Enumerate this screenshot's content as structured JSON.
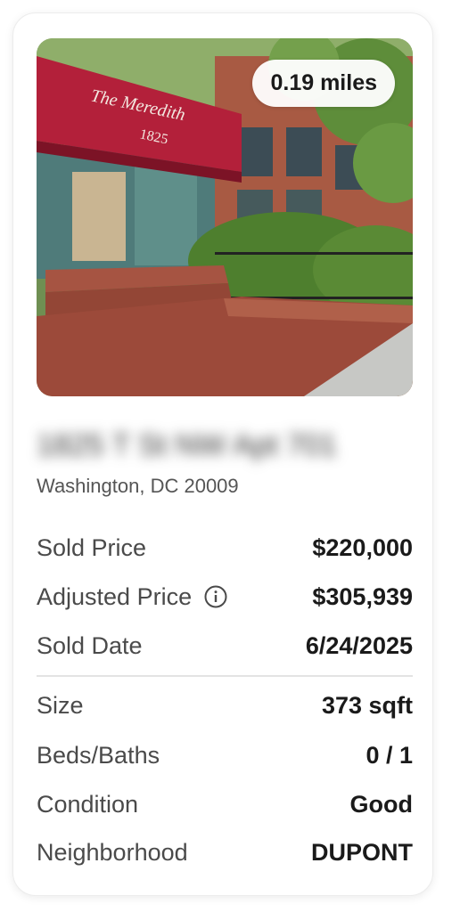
{
  "listing": {
    "distance": "0.19 miles",
    "address": "1825 T St NW Apt 701",
    "city": "Washington, DC 20009",
    "awning_name": "The Meredith",
    "awning_number": "1825"
  },
  "sale": {
    "sold_price_label": "Sold Price",
    "sold_price": "$220,000",
    "adjusted_price_label": "Adjusted Price",
    "adjusted_price": "$305,939",
    "sold_date_label": "Sold Date",
    "sold_date": "6/24/2025"
  },
  "details": {
    "size_label": "Size",
    "size": "373 sqft",
    "beds_baths_label": "Beds/Baths",
    "beds_baths": "0 / 1",
    "condition_label": "Condition",
    "condition": "Good",
    "neighborhood_label": "Neighborhood",
    "neighborhood": "DUPONT"
  },
  "icons": {
    "info": "info-icon"
  },
  "colors": {
    "awning": "#b3203a",
    "brick": "#9c4a3a"
  }
}
